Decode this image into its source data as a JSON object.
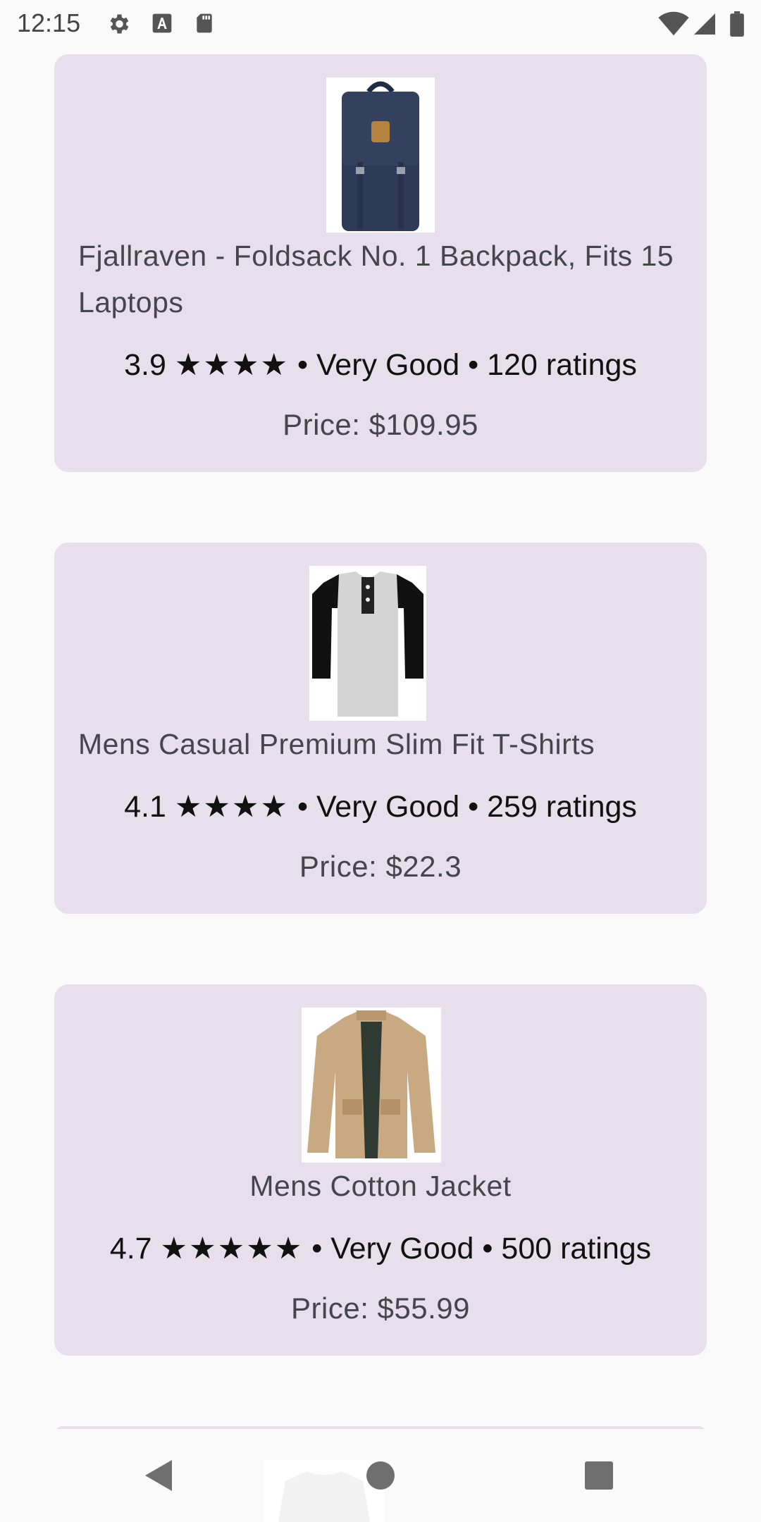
{
  "status_bar": {
    "time": "12:15",
    "icons": [
      "gear-icon",
      "font-a-icon",
      "sd-card-icon",
      "wifi-icon",
      "signal-icon",
      "battery-icon"
    ]
  },
  "products": [
    {
      "title": "Fjallraven - Foldsack No. 1 Backpack, Fits 15 Laptops",
      "rating": "3.9",
      "stars": "★★★★",
      "label": "Very Good",
      "ratings": "120 ratings",
      "price": "Price: $109.95",
      "image_icon": "backpack-image"
    },
    {
      "title": "Mens Casual Premium Slim Fit T-Shirts",
      "rating": "4.1",
      "stars": "★★★★",
      "label": "Very Good",
      "ratings": "259 ratings",
      "price": "Price: $22.3",
      "image_icon": "tshirt-image"
    },
    {
      "title": "Mens Cotton Jacket",
      "rating": "4.7",
      "stars": "★★★★★",
      "label": "Very Good",
      "ratings": "500 ratings",
      "price": "Price: $55.99",
      "image_icon": "jacket-image"
    }
  ],
  "separator": "•",
  "colors": {
    "background": "#fafafa",
    "card": "#e7dfeb",
    "text": "#46454c"
  },
  "nav": [
    "back-icon",
    "home-icon",
    "recents-icon"
  ]
}
